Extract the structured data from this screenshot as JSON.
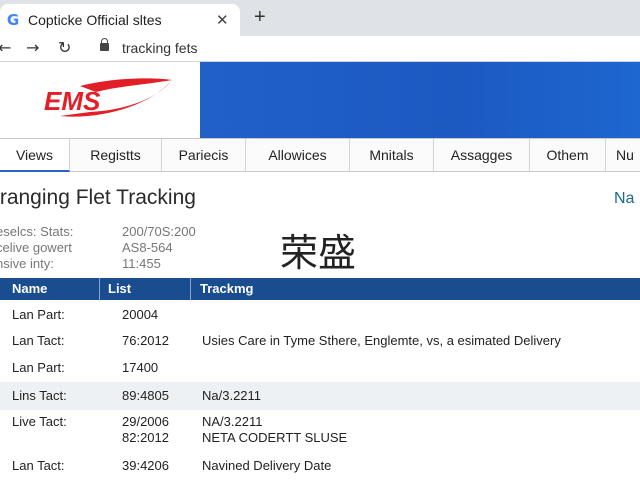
{
  "browser": {
    "tab_title": "Copticke Official sltes",
    "tab_icon": "google-g-icon",
    "url": "tracking fets",
    "icons": [
      "back-arrow-icon",
      "forward-arrow-icon",
      "reload-icon",
      "lock-icon",
      "close-icon",
      "plus-icon"
    ]
  },
  "brand": {
    "logo_text": "EMS",
    "logo_color": "#e21f26",
    "banner_color": "#1f5fc8"
  },
  "nav": {
    "items": [
      "Views",
      "Registts",
      "Pariecis",
      "Allowices",
      "Mnitals",
      "Assagges",
      "Othem",
      "Nu"
    ]
  },
  "page": {
    "title": "tranging Flet Tracking",
    "title_right": "Na",
    "overlay_label": "荣盛"
  },
  "stats": [
    {
      "label": "eselcs: Stats:",
      "value": "200/70S:200"
    },
    {
      "label": "celive gowert",
      "value": "AS8-564"
    },
    {
      "label": "nsive inty:",
      "value": "11:455"
    }
  ],
  "table": {
    "headers": [
      "Name",
      "List",
      "Trackmg"
    ],
    "rows": [
      {
        "name": "Lan Part:",
        "list": "20004",
        "tracking": ""
      },
      {
        "name": "Lan Tact:",
        "list": "76:2012",
        "tracking": "Usies Care in Tyme Sthere, Englemte, vs, a esimated Delivery"
      },
      {
        "name": "Lan Part:",
        "list": "17400",
        "tracking": ""
      },
      {
        "name": "Lins Tact:",
        "list": "89:4805",
        "tracking": "Na/3.2211"
      },
      {
        "name": "Live Tact:",
        "list": "29/2006",
        "list2": "82:2012",
        "tracking": "NA/3.2211",
        "tracking2": "NETA CODERTT SLUSE"
      },
      {
        "name": "Lan Tact:",
        "list": "39:4206",
        "tracking": "Navined Delivery Date"
      }
    ]
  }
}
